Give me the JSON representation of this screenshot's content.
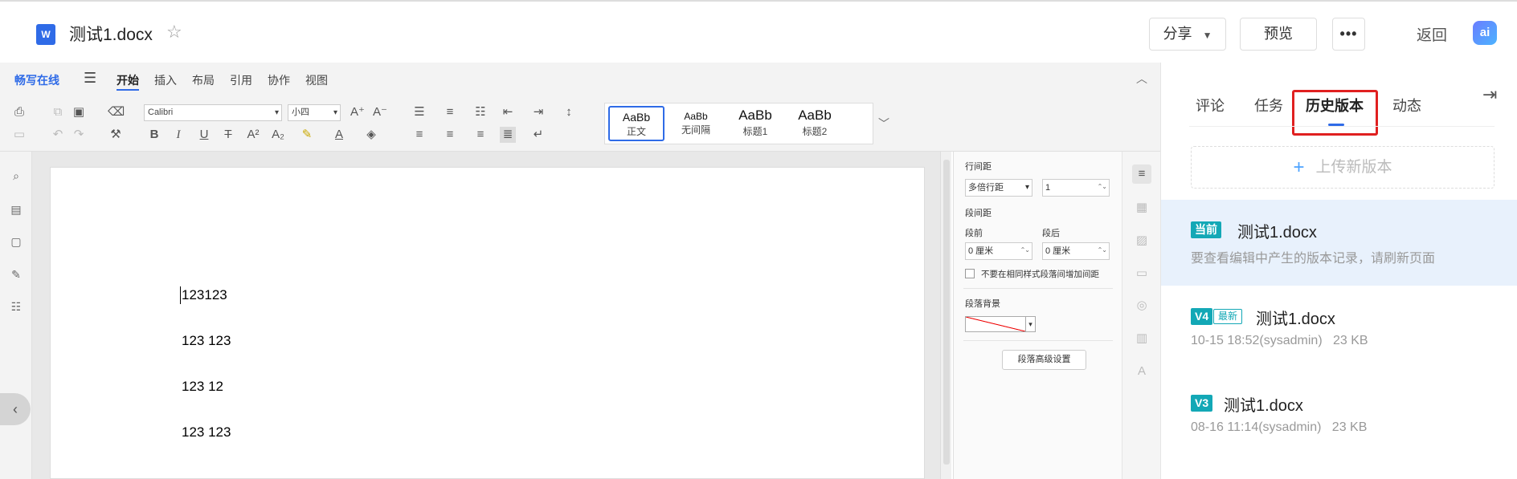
{
  "header": {
    "doc_icon": "W",
    "title": "测试1.docx",
    "share_label": "分享",
    "preview_label": "预览",
    "more_label": "•••",
    "back_label": "返回",
    "ai_label": "ai"
  },
  "ribbon": {
    "brand": "畅写在线",
    "tabs": [
      "开始",
      "插入",
      "布局",
      "引用",
      "协作",
      "视图"
    ],
    "active_tab": "开始",
    "font_name": "Calibri",
    "font_size": "小四",
    "styles": [
      {
        "preview": "AaBb",
        "name": "正文"
      },
      {
        "preview": "AaBb",
        "name": "无间隔"
      },
      {
        "preview": "AaBb",
        "name": "标题1"
      },
      {
        "preview": "AaBb",
        "name": "标题2"
      }
    ]
  },
  "document": {
    "lines": [
      "123123",
      "123 123",
      "123 12",
      "123 123"
    ]
  },
  "paragraph_panel": {
    "line_spacing_label": "行间距",
    "line_spacing_type": "多倍行距",
    "line_spacing_value": "1",
    "para_spacing_label": "段间距",
    "before_label": "段前",
    "after_label": "段后",
    "before_value": "0 厘米",
    "after_value": "0 厘米",
    "no_space_same_style": "不要在相同样式段落间增加间距",
    "background_label": "段落背景",
    "advanced_label": "段落高级设置"
  },
  "sidebar": {
    "tabs": [
      "评论",
      "任务",
      "历史版本",
      "动态"
    ],
    "active_tab": "历史版本",
    "upload_label": "上传新版本",
    "current": {
      "badge": "当前",
      "name": "测试1.docx",
      "hint": "要查看编辑中产生的版本记录，请刷新页面"
    },
    "versions": [
      {
        "badge": "V4",
        "tag": "最新",
        "name": "测试1.docx",
        "meta": "10-15 18:52(sysadmin)   23 KB"
      },
      {
        "badge": "V3",
        "tag": "",
        "name": "测试1.docx",
        "meta": "08-16 11:14(sysadmin)   23 KB"
      }
    ]
  },
  "colors": {
    "accent": "#2f6be7",
    "version_badge": "#13a8b6",
    "highlight_box": "#e02020"
  }
}
